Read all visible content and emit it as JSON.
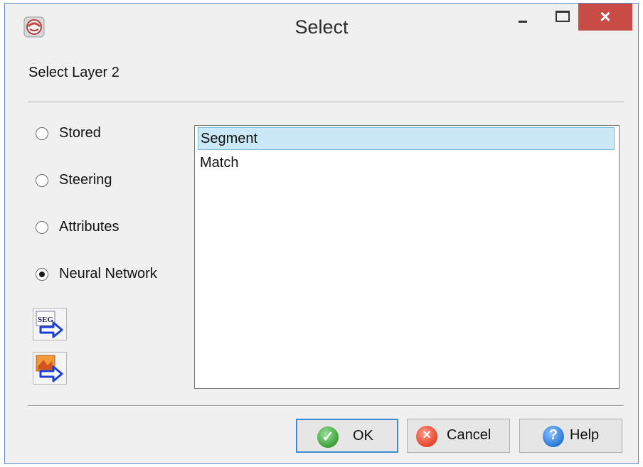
{
  "window": {
    "title": "Select",
    "controls": {
      "minimize": "minimize",
      "maximize": "maximize",
      "close": "×"
    }
  },
  "heading": "Select Layer 2",
  "options": [
    {
      "label": "Stored",
      "checked": false
    },
    {
      "label": "Steering",
      "checked": false
    },
    {
      "label": "Attributes",
      "checked": false
    },
    {
      "label": "Neural Network",
      "checked": true
    }
  ],
  "tools": {
    "seg_icon_text": "SEG",
    "items": [
      {
        "name": "seg-arrow-icon"
      },
      {
        "name": "image-arrow-icon"
      }
    ]
  },
  "list": {
    "items": [
      "Segment",
      "Match"
    ],
    "selected": "Segment"
  },
  "buttons": {
    "ok": "OK",
    "cancel": "Cancel",
    "help": "Help",
    "ok_glyph": "✓",
    "cancel_glyph": "×",
    "help_glyph": "?"
  },
  "colors": {
    "close_button": "#c94b45",
    "selection": "#cbe8f6",
    "default_button_border": "#3c8dd8"
  }
}
